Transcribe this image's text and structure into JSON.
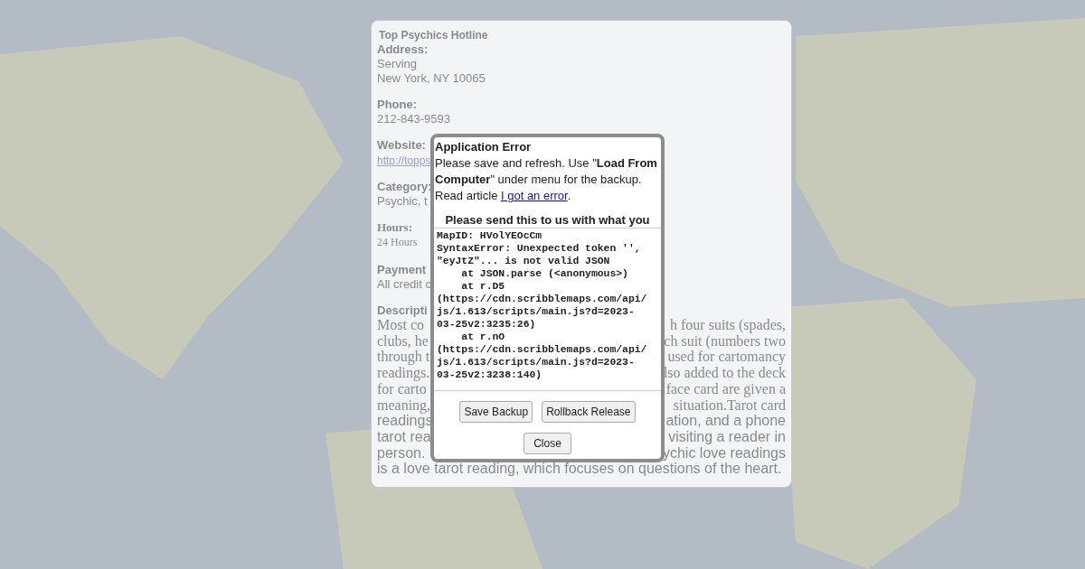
{
  "info_panel": {
    "title": "Top Psychics Hotline",
    "fields": [
      {
        "label": "Address:",
        "lines": [
          "Serving",
          "New York, NY 10065"
        ],
        "kind": "text"
      },
      {
        "label": "Phone:",
        "lines": [
          "212-843-9593"
        ],
        "kind": "text"
      },
      {
        "label": "Website:",
        "lines": [
          "http://topps"
        ],
        "kind": "link"
      },
      {
        "label": "Category:",
        "lines": [
          "Psychic, t"
        ],
        "kind": "text"
      },
      {
        "label": "Hours:",
        "lines": [
          "24 Hours"
        ],
        "kind": "serif"
      },
      {
        "label": "Payment",
        "lines": [
          "All credit c"
        ],
        "kind": "text"
      }
    ],
    "description": {
      "label": "Descripti",
      "serif_lines": [
        {
          "left": "Most co",
          "right": "h four suits (spades,"
        },
        {
          "left": "clubs, he",
          "right": "ch suit (numbers two"
        },
        {
          "left": "through t",
          "right": "used for cartomancy"
        },
        {
          "left": "readings.",
          "right": "lso added to the deck"
        },
        {
          "left": "for carto",
          "right": "face card are given a"
        },
        {
          "left": "meaning,",
          "right": "situation.Tarot card"
        }
      ],
      "sans_lines": [
        {
          "left": "readings",
          "right": "ation, and a phone"
        },
        {
          "left": "tarot rea",
          "right": "visiting a reader in"
        },
        {
          "left": "person.",
          "right": "ychic love readings"
        }
      ],
      "last_line": "is a love tarot reading, which focuses on questions of the heart."
    }
  },
  "dialog": {
    "title": "Application Error",
    "message_before": "Please save and refresh. Use \"**Load From Computer**\" under menu for the backup. Read article ",
    "link": "I got an error",
    "message_after": ".",
    "subheading": "Please send this to us with what you",
    "log": [
      "MapID: HVolYEOcCm",
      "SyntaxError: Unexpected token '',",
      "\"eyJtZ\"... is not valid JSON",
      "    at JSON.parse (<anonymous>)",
      "    at r.D5",
      "(https://cdn.scribblemaps.com/api/",
      "js/1.613/scripts/main.js?d=2023-",
      "03-25v2:3235:26)",
      "    at r.nO",
      "(https://cdn.scribblemaps.com/api/",
      "js/1.613/scripts/main.js?d=2023-",
      "03-25v2:3238:140)"
    ],
    "buttons": [
      "Save Backup",
      "Rollback Release"
    ],
    "close": "Close"
  }
}
